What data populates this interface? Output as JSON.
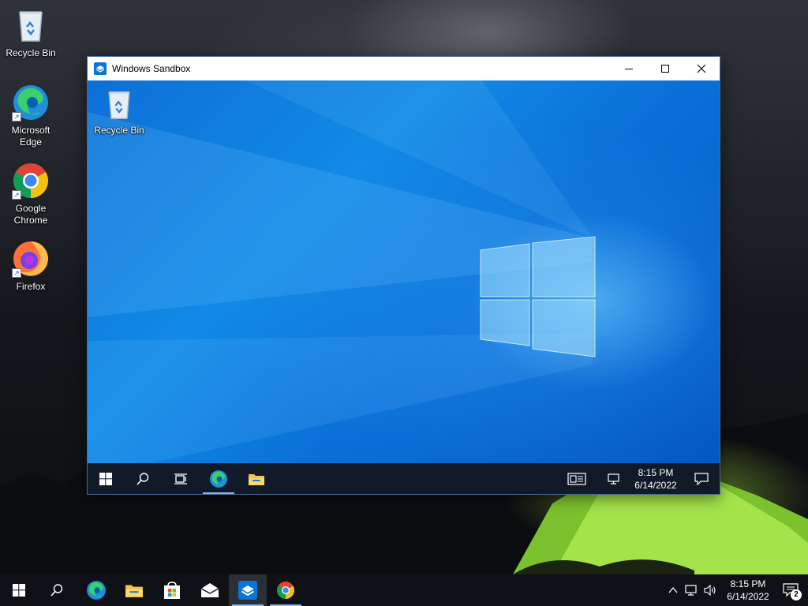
{
  "host_desktop": {
    "icons": [
      {
        "label": "Recycle Bin"
      },
      {
        "label": "Microsoft Edge"
      },
      {
        "label": "Google Chrome"
      },
      {
        "label": "Firefox"
      }
    ]
  },
  "sandbox_window": {
    "title": "Windows Sandbox",
    "desktop_icons": [
      {
        "label": "Recycle Bin"
      }
    ],
    "taskbar": {
      "clock_time": "8:15 PM",
      "clock_date": "6/14/2022"
    }
  },
  "host_taskbar": {
    "clock_time": "8:15 PM",
    "clock_date": "6/14/2022",
    "notification_count": "2"
  },
  "colors": {
    "sandbox_accent": "#0a74da",
    "taskbar_bg": "#0f1116",
    "tent_green": "#8fd63a"
  }
}
